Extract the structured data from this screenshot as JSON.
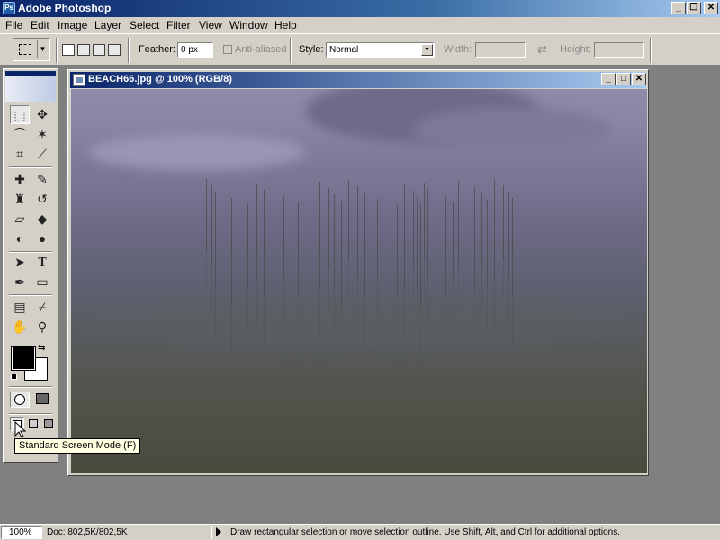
{
  "app": {
    "title": "Adobe Photoshop",
    "icon": "photoshop-icon"
  },
  "window_controls": {
    "minimize": "_",
    "restore": "❐",
    "close": "✕"
  },
  "menu": [
    "File",
    "Edit",
    "Image",
    "Layer",
    "Select",
    "Filter",
    "View",
    "Window",
    "Help"
  ],
  "options": {
    "feather_label": "Feather:",
    "feather_value": "0 px",
    "anti_aliased_label": "Anti-aliased",
    "style_label": "Style:",
    "style_value": "Normal",
    "width_label": "Width:",
    "height_label": "Height:",
    "swap_glyph": "⇄"
  },
  "toolbox": {
    "tools": [
      {
        "name": "marquee-tool",
        "glyph": "⬚",
        "active": true
      },
      {
        "name": "move-tool",
        "glyph": "✥"
      },
      {
        "name": "lasso-tool",
        "glyph": "⌒"
      },
      {
        "name": "magic-wand-tool",
        "glyph": "✶"
      },
      {
        "name": "crop-tool",
        "glyph": "⌗"
      },
      {
        "name": "slice-tool",
        "glyph": "⟋"
      },
      {
        "name": "healing-brush-tool",
        "glyph": "✚"
      },
      {
        "name": "brush-tool",
        "glyph": "✎"
      },
      {
        "name": "stamp-tool",
        "glyph": "♜"
      },
      {
        "name": "history-brush-tool",
        "glyph": "↺"
      },
      {
        "name": "eraser-tool",
        "glyph": "▱"
      },
      {
        "name": "paint-bucket-tool",
        "glyph": "◆"
      },
      {
        "name": "blur-tool",
        "glyph": "◐"
      },
      {
        "name": "dodge-tool",
        "glyph": "●"
      },
      {
        "name": "path-selection-tool",
        "glyph": "➤"
      },
      {
        "name": "type-tool",
        "glyph": "T"
      },
      {
        "name": "pen-tool",
        "glyph": "✒"
      },
      {
        "name": "rectangle-tool",
        "glyph": "▭"
      },
      {
        "name": "notes-tool",
        "glyph": "▤"
      },
      {
        "name": "eyedropper-tool",
        "glyph": "⌿"
      },
      {
        "name": "hand-tool",
        "glyph": "✋"
      },
      {
        "name": "zoom-tool",
        "glyph": "⚲"
      }
    ]
  },
  "document": {
    "title": "BEACH66.jpg @ 100% (RGB/8)"
  },
  "tooltip": {
    "text": "Standard Screen Mode (F)"
  },
  "status": {
    "zoom": "100%",
    "doc": "Doc: 802,5K/802,5K",
    "message": "Draw rectangular selection or move selection outline.  Use Shift, Alt, and Ctrl for additional options."
  }
}
